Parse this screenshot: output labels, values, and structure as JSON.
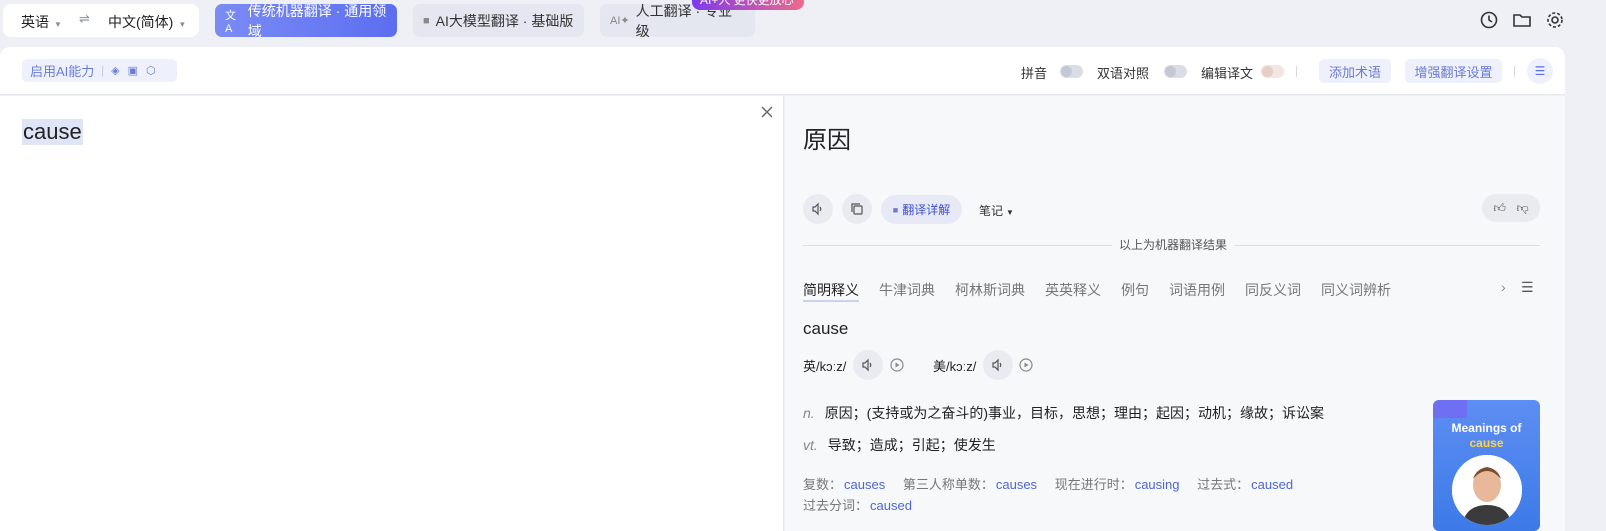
{
  "lang": {
    "source": "英语",
    "target": "中文(简体)"
  },
  "modes": [
    {
      "label": "传统机器翻译 · 通用领域",
      "icon": "translate-icon"
    },
    {
      "label": "AI大模型翻译 · 基础版",
      "icon": "cube-icon"
    },
    {
      "label": "人工翻译 · 专业级",
      "icon": "ai-sparkle-icon"
    }
  ],
  "promo_badge": "AI+人 更快更放心",
  "toolbar": {
    "ai_label": "启用AI能力",
    "pinyin": "拼音",
    "bilingual": "双语对照",
    "edit": "编辑译文",
    "add_term": "添加术语",
    "enhance": "增强翻译设置"
  },
  "source_text": "cause",
  "result": {
    "main": "原因",
    "detail_label": "翻译详解",
    "notes_label": "笔记",
    "machine_note": "以上为机器翻译结果"
  },
  "dict_tabs": [
    "简明释义",
    "牛津词典",
    "柯林斯词典",
    "英英释义",
    "例句",
    "词语用例",
    "同反义词",
    "同义词辨析"
  ],
  "word": {
    "headword": "cause",
    "uk": "英/kɔːz/",
    "us": "美/kɔːz/",
    "definitions": [
      {
        "pos": "n.",
        "text": "原因；(支持或为之奋斗的)事业，目标，思想；理由；起因；动机；缘故；诉讼案"
      },
      {
        "pos": "vt.",
        "text": "导致；造成；引起；使发生"
      }
    ],
    "forms": [
      {
        "label": "复数：",
        "value": "causes"
      },
      {
        "label": "第三人称单数：",
        "value": "causes"
      },
      {
        "label": "现在进行时：",
        "value": "causing"
      },
      {
        "label": "过去式：",
        "value": "caused"
      },
      {
        "label": "过去分词：",
        "value": "caused"
      }
    ]
  },
  "promo_card": {
    "title": "Meanings of",
    "word": "cause"
  },
  "colors": {
    "accent": "#5c6ef0",
    "link": "#4d66d6",
    "panel_bg": "#f7f8fa"
  }
}
